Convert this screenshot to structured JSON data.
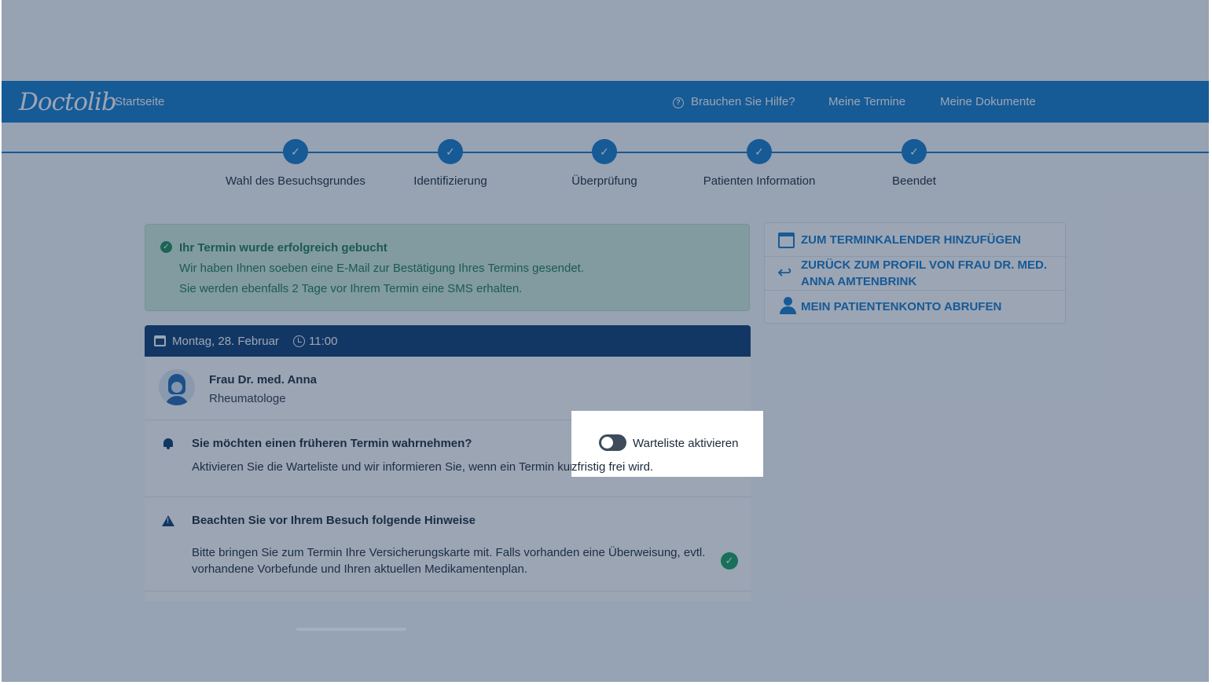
{
  "navbar": {
    "logo": "Doctolib",
    "home": "Startseite",
    "help": "Brauchen Sie Hilfe?",
    "appointments": "Meine Termine",
    "documents": "Meine Dokumente"
  },
  "steps": [
    {
      "label": "Wahl des Besuchsgrundes",
      "state": "done"
    },
    {
      "label": "Identifizierung",
      "state": "done"
    },
    {
      "label": "Überprüfung",
      "state": "done"
    },
    {
      "label": "Patienten Information",
      "state": "done"
    },
    {
      "label": "Beendet",
      "state": "done"
    }
  ],
  "success": {
    "title": "Ihr Termin wurde erfolgreich gebucht",
    "line1": "Wir haben Ihnen soeben eine E-Mail zur Bestätigung Ihres Termins gesendet.",
    "line2": "Sie werden ebenfalls 2 Tage vor Ihrem Termin eine SMS erhalten."
  },
  "appointment": {
    "date": "Montag, 28. Februar",
    "time": "11:00",
    "doctor_name": "Frau Dr. med. Anna",
    "specialty": "Rheumatologe",
    "waitlist_title": "Sie möchten einen früheren Termin wahrnehmen?",
    "waitlist_text_a": "Aktivieren Sie die Warteliste und wir informieren Sie, wenn ein Termin kur",
    "waitlist_text_b": "zfristig frei wird.",
    "waitlist_toggle_label": "Warteliste aktivieren",
    "notes_title": "Beachten Sie vor Ihrem Besuch folgende Hinweise",
    "notes_line1": "Bitte bringen Sie zum Termin Ihre Versicherungskarte mit. Falls vorhanden eine Überweisung, evtl.",
    "notes_line2": "vorhandene Vorbefunde und Ihren aktuellen Medikamentenplan."
  },
  "actions": {
    "add_calendar": "ZUM TERMINKALENDER HINZUFÜGEN",
    "back_profile_1": "ZURÜCK ZUM PROFIL VON FRAU DR. MED.",
    "back_profile_2": "ANNA AMTENBRINK",
    "patient_account": "MEIN PATIENTENKONTO ABRUFEN"
  },
  "colors": {
    "primary": "#107aca",
    "header_dark": "#0b3b70",
    "success_green": "#1b7a4b"
  }
}
